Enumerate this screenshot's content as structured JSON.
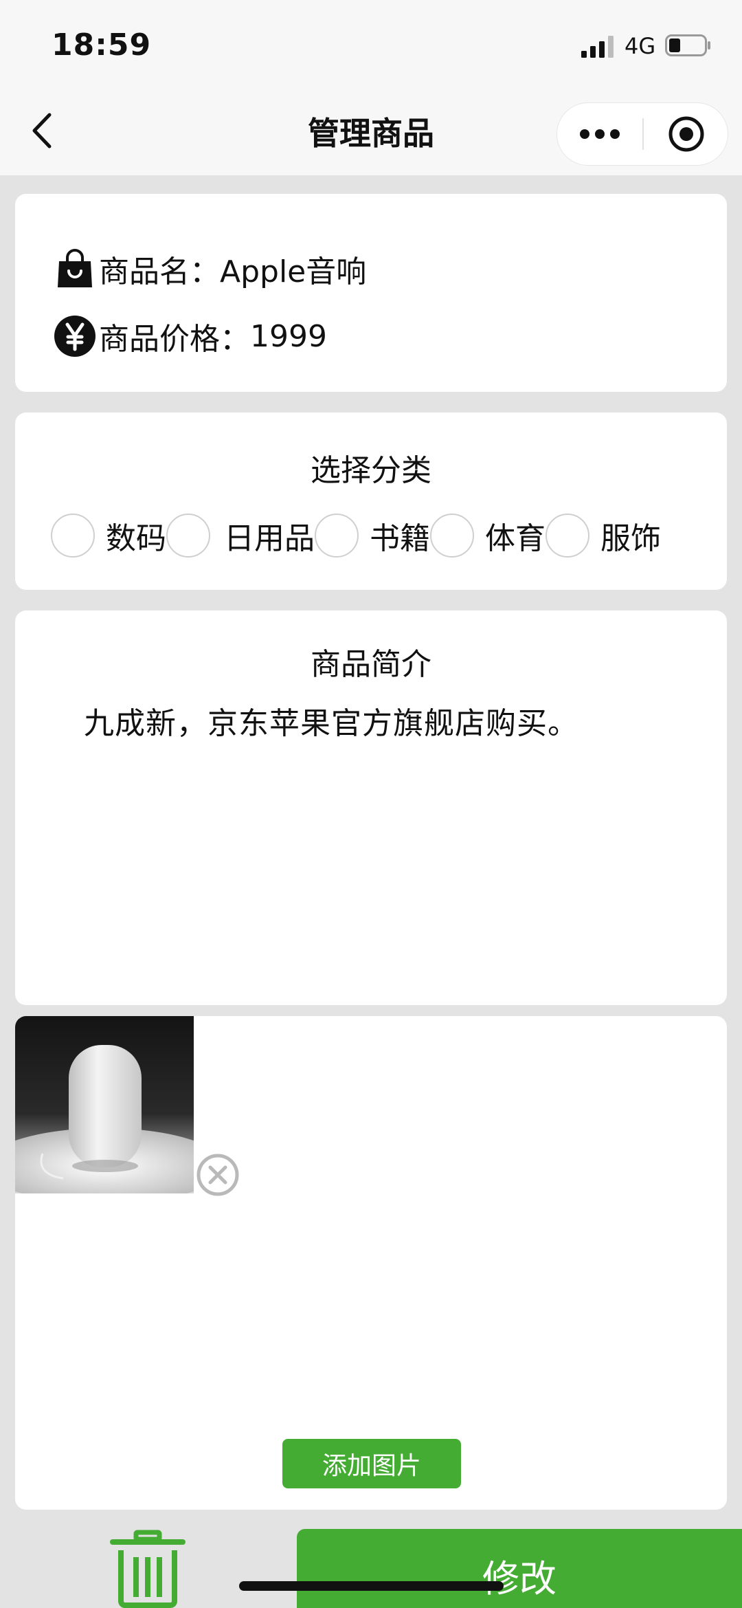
{
  "status_bar": {
    "time": "18:59",
    "network": "4G"
  },
  "nav": {
    "title": "管理商品"
  },
  "product_info": {
    "name_label": "商品名：",
    "name_value": "Apple音响",
    "price_label": "商品价格：",
    "price_value": "1999"
  },
  "category": {
    "title": "选择分类",
    "options": [
      {
        "label": "数码",
        "checked": false
      },
      {
        "label": "日用品",
        "checked": false
      },
      {
        "label": "书籍",
        "checked": false
      },
      {
        "label": "体育",
        "checked": false
      },
      {
        "label": "服饰",
        "checked": false
      }
    ]
  },
  "intro": {
    "title": "商品简介",
    "text": "九成新，京东苹果官方旗舰店购买。"
  },
  "images": {
    "add_button_label": "添加图片"
  },
  "actions": {
    "modify_label": "修改"
  },
  "colors": {
    "accent_green": "#44ab33",
    "background": "#e3e3e3",
    "card": "#ffffff"
  },
  "icons": {
    "back": "chevron-left-icon",
    "more": "more-dots-icon",
    "close_miniprogram": "target-close-icon",
    "name": "shopping-bag-icon",
    "price": "yen-icon",
    "remove_photo": "circle-x-icon",
    "delete": "trash-icon"
  }
}
